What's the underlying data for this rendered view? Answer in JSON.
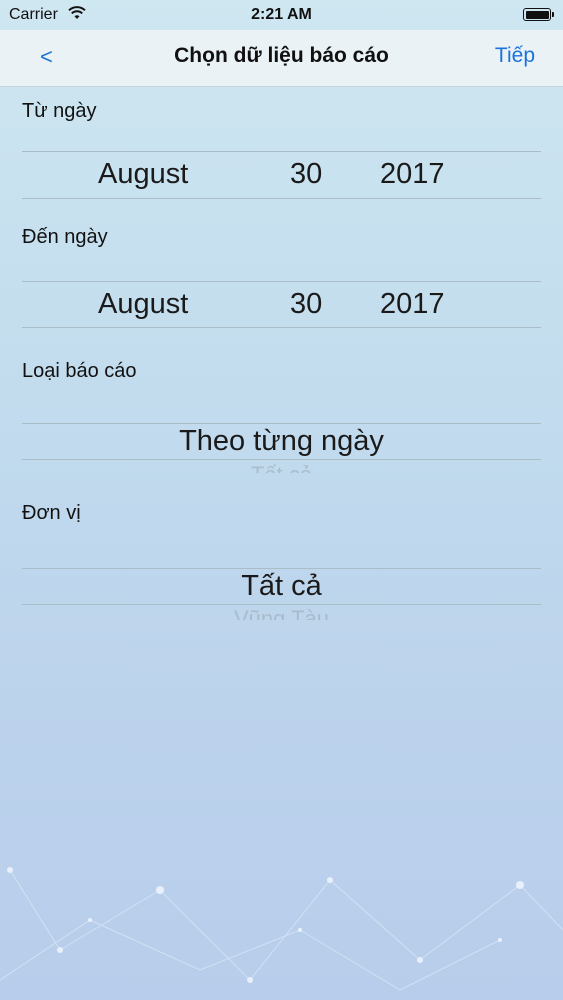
{
  "status": {
    "carrier": "Carrier",
    "time": "2:21 AM"
  },
  "nav": {
    "back": "<",
    "title": "Chọn dữ liệu báo cáo",
    "next": "Tiếp"
  },
  "from": {
    "label": "Từ ngày",
    "month": "August",
    "day": "30",
    "year": "2017"
  },
  "to": {
    "label": "Đến ngày",
    "month": "August",
    "day": "30",
    "year": "2017"
  },
  "report_type": {
    "label": "Loại báo cáo",
    "value": "Theo từng ngày",
    "next_option": "Tất cả"
  },
  "unit": {
    "label": "Đơn vị",
    "value": "Tất cả",
    "next_option": "Vũng Tàu"
  },
  "colors": {
    "accent": "#1a73d9",
    "divider": "#a9bcc7"
  },
  "icons": {
    "wifi": "wifi-icon",
    "battery": "battery-icon"
  }
}
